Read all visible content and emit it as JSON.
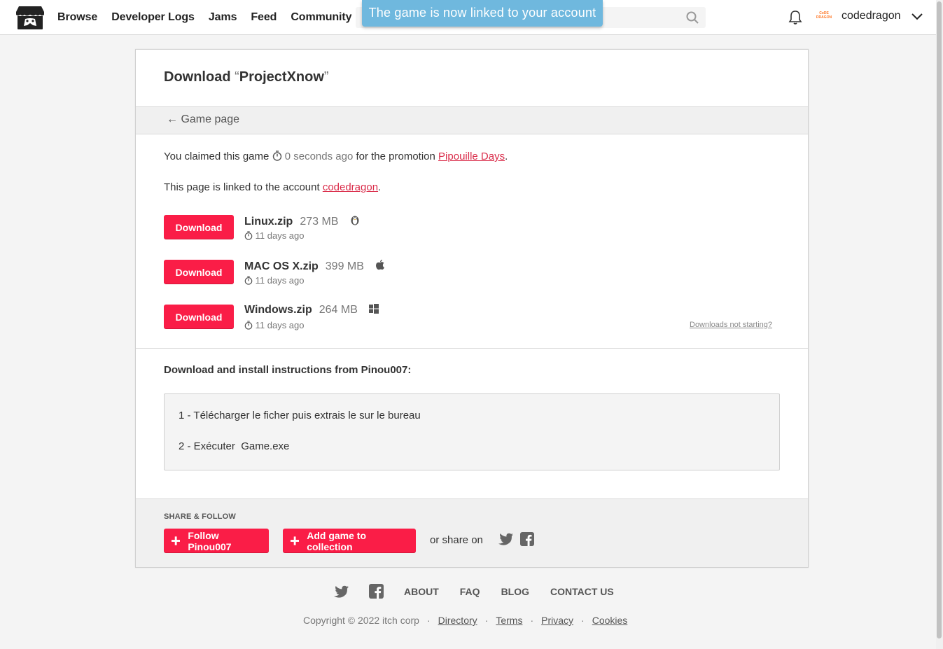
{
  "nav": {
    "items": [
      "Browse",
      "Developer Logs",
      "Jams",
      "Feed",
      "Community"
    ]
  },
  "toast": "The game is now linked to your account",
  "user": {
    "name": "codedragon",
    "avatar_text": "CoDE DRAGON"
  },
  "page": {
    "title_prefix": "Download ",
    "open_quote": "“",
    "game_name": "ProjectXnow",
    "close_quote": "”",
    "back_link": "Game page",
    "claim_text": "You claimed this game",
    "claim_time": "0 seconds ago",
    "claim_promo_text": "for the promotion",
    "promo_name": "Pipouille Days",
    "linked_text": "This page is linked to the account",
    "linked_account": "codedragon"
  },
  "downloads": [
    {
      "button": "Download",
      "name": "Linux.zip",
      "size": "273 MB",
      "os_icon": "linux-icon",
      "date": "11 days ago"
    },
    {
      "button": "Download",
      "name": "MAC OS X.zip",
      "size": "399 MB",
      "os_icon": "apple-icon",
      "date": "11 days ago"
    },
    {
      "button": "Download",
      "name": "Windows.zip",
      "size": "264 MB",
      "os_icon": "windows-icon",
      "date": "11 days ago"
    }
  ],
  "downloads_not_starting": "Downloads not starting?",
  "instructions": {
    "title": "Download and install instructions from Pinou007:",
    "lines": [
      "1 - Télécharger le ficher puis extrais le sur le bureau",
      "2 - Exécuter  Game.exe"
    ]
  },
  "share": {
    "title": "SHARE & FOLLOW",
    "follow_label": "Follow Pinou007",
    "collection_label": "Add game to collection",
    "share_on": "or share on"
  },
  "footer": {
    "links": [
      "ABOUT",
      "FAQ",
      "BLOG",
      "CONTACT US"
    ],
    "copyright": "Copyright © 2022 itch corp",
    "small_links": [
      "Directory",
      "Terms",
      "Privacy",
      "Cookies"
    ]
  },
  "colors": {
    "accent": "#fa1d47",
    "link": "#da2c4a",
    "toast": "#6fb8de"
  }
}
